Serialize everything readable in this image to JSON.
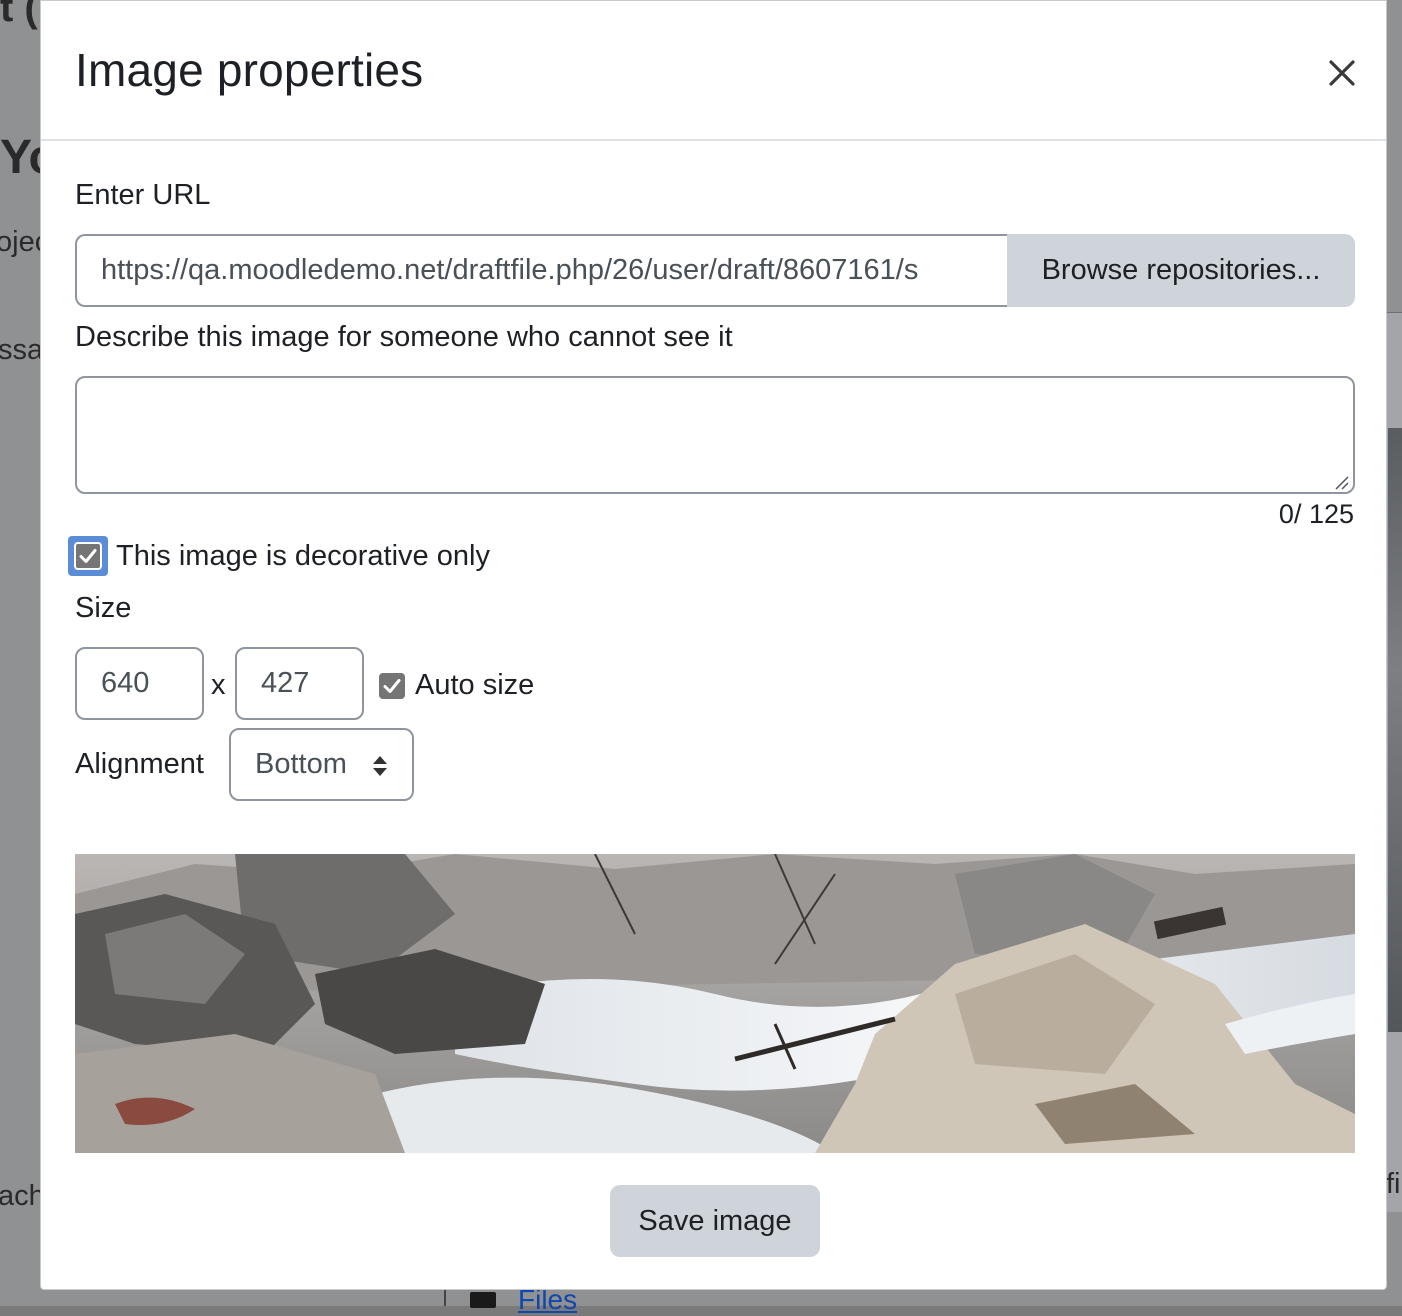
{
  "background": {
    "fragments": [
      "t (",
      "Yo",
      "ojec",
      "ssa",
      "ach",
      "fi"
    ],
    "files_link": "Files"
  },
  "modal": {
    "title": "Image properties",
    "close_label": "×",
    "url": {
      "label": "Enter URL",
      "value": "https://qa.moodledemo.net/draftfile.php/26/user/draft/8607161/s",
      "browse_label": "Browse repositories..."
    },
    "alt": {
      "label": "Describe this image for someone who cannot see it",
      "value": "",
      "counter": "0/ 125"
    },
    "decorative": {
      "label": "This image is decorative only",
      "checked": true
    },
    "size": {
      "label": "Size",
      "width": "640",
      "height": "427",
      "separator": "x",
      "auto_label": "Auto size",
      "auto_checked": true
    },
    "alignment": {
      "label": "Alignment",
      "selected": "Bottom"
    },
    "preview_alt": "",
    "save_label": "Save image"
  },
  "colors": {
    "checkbox": "#757575",
    "focus_ring": "#5b8dd6",
    "button_bg": "#ced4da",
    "border": "#8f959e"
  }
}
